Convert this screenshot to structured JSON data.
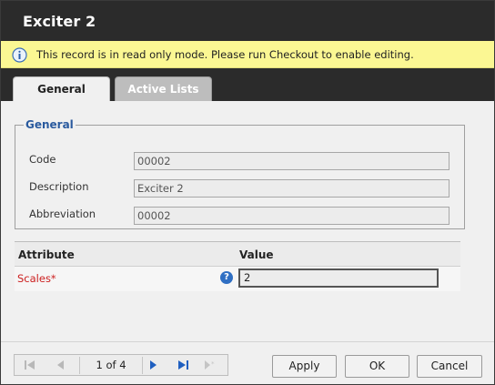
{
  "window": {
    "title": "Exciter 2"
  },
  "notice": {
    "icon": "info-icon",
    "message": "This record is in read only mode. Please run Checkout to enable editing."
  },
  "tabs": [
    {
      "label": "General",
      "selected": true
    },
    {
      "label": "Active Lists",
      "selected": false
    }
  ],
  "general_group": {
    "legend": "General",
    "fields": [
      {
        "label": "Code",
        "value": "00002"
      },
      {
        "label": "Description",
        "value": "Exciter 2"
      },
      {
        "label": "Abbreviation",
        "value": "00002"
      }
    ]
  },
  "attributes": {
    "columns": {
      "attribute": "Attribute",
      "value": "Value"
    },
    "rows": [
      {
        "name": "Scales*",
        "help_icon": "question-icon",
        "help_glyph": "?",
        "value": "2"
      }
    ]
  },
  "pager": {
    "text": "1 of 4"
  },
  "buttons": {
    "apply": "Apply",
    "ok": "OK",
    "cancel": "Cancel"
  },
  "colors": {
    "titlebar": "#2b2b2b",
    "notice_bg": "#fbf793",
    "legend": "#2a5a9e",
    "required_label": "#cc2020",
    "pager_icon": "#1f5fc0"
  }
}
